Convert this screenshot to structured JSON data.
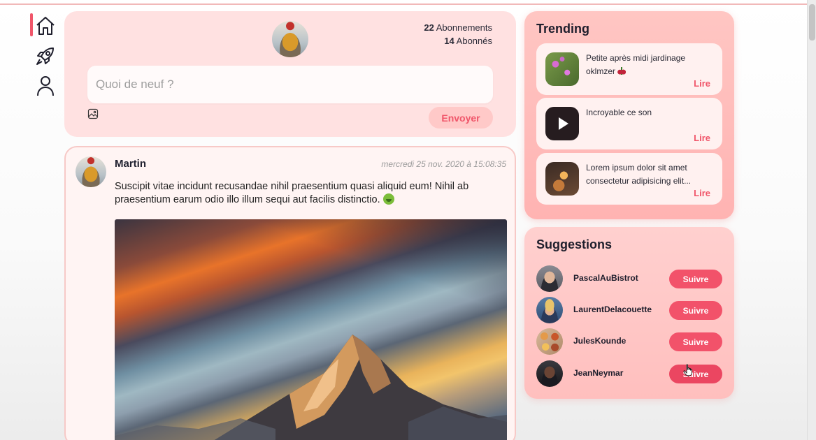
{
  "nav": {
    "items": [
      {
        "name": "home",
        "icon": "home-icon",
        "active": true
      },
      {
        "name": "explore",
        "icon": "rocket-icon",
        "active": false
      },
      {
        "name": "profile",
        "icon": "user-icon",
        "active": false
      }
    ]
  },
  "composer": {
    "following_count": "22",
    "following_label": "Abonnements",
    "followers_count": "14",
    "followers_label": "Abonnés",
    "placeholder": "Quoi de neuf ?",
    "image_icon": "image-icon",
    "send_label": "Envoyer"
  },
  "post": {
    "author": "Martin",
    "date": "mercredi 25 nov. 2020 à 15:08:35",
    "text": "Suscipit vitae incidunt recusandae nihil praesentium quasi aliquid eum! Nihil ab praesentium earum odio illo illum sequi aut facilis distinctio.",
    "emoji": "nauseated-face-emoji"
  },
  "trending": {
    "title": "Trending",
    "items": [
      {
        "text": "Petite après midi jardinage oklmzer",
        "emoji": "cherries-emoji",
        "link": "Lire",
        "thumb": "flowers"
      },
      {
        "text": "Incroyable ce son",
        "link": "Lire",
        "thumb": "video-play-icon"
      },
      {
        "text": "Lorem ipsum dolor sit amet consectetur adipisicing elit...",
        "link": "Lire",
        "thumb": "candle"
      }
    ]
  },
  "suggestions": {
    "title": "Suggestions",
    "users": [
      {
        "name": "PascalAuBistrot",
        "button": "Suivre"
      },
      {
        "name": "LaurentDelacouette",
        "button": "Suivre"
      },
      {
        "name": "JulesKounde",
        "button": "Suivre"
      },
      {
        "name": "JeanNeymar",
        "button": "Suivre"
      }
    ]
  },
  "colors": {
    "accent": "#f0566a",
    "card_pink": "#ffe1e1",
    "trending_pink": "#ffb3b2"
  }
}
